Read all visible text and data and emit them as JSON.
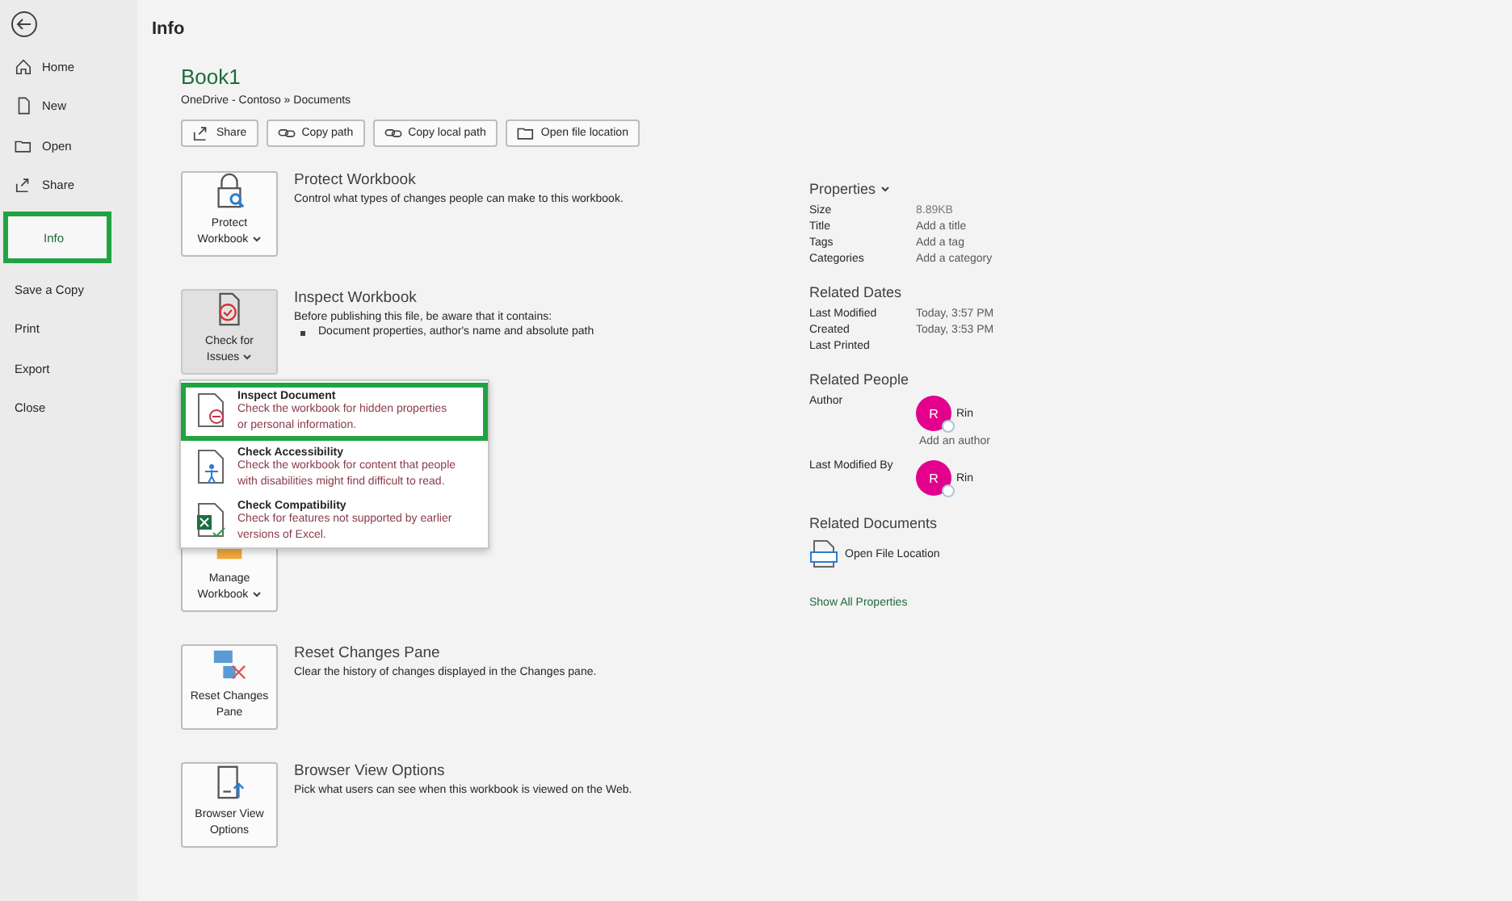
{
  "sidebar": {
    "items": [
      {
        "label": "Home",
        "selected": false
      },
      {
        "label": "New",
        "selected": false
      },
      {
        "label": "Open",
        "selected": false
      },
      {
        "label": "Share",
        "selected": false
      },
      {
        "label": "Info",
        "selected": true
      },
      {
        "label": "Save a Copy",
        "selected": false
      },
      {
        "label": "Print",
        "selected": false
      },
      {
        "label": "Export",
        "selected": false
      },
      {
        "label": "Close",
        "selected": false
      }
    ]
  },
  "page_title": "Info",
  "file": {
    "name": "Book1",
    "path": "OneDrive - Contoso » Documents"
  },
  "file_buttons": [
    {
      "label": "Share"
    },
    {
      "label": "Copy path"
    },
    {
      "label": "Copy local path"
    },
    {
      "label": "Open file location"
    }
  ],
  "sections": [
    {
      "button": [
        "Protect",
        "Workbook"
      ],
      "dropdown": true,
      "title": "Protect Workbook",
      "lines": [
        "Control what types of changes people can make to this workbook."
      ],
      "pressed": false
    },
    {
      "button": [
        "Check for",
        "Issues"
      ],
      "dropdown": true,
      "title": "Inspect Workbook",
      "lines": [
        "Before publishing this file, be aware that it contains:"
      ],
      "bullets": [
        "Document properties, author's name and absolute path"
      ],
      "pressed": true
    },
    {
      "button": [
        "Manage",
        "Workbook"
      ],
      "dropdown": true,
      "pressed": false
    },
    {
      "button": [
        "Reset Changes",
        "Pane"
      ],
      "title": "Reset Changes Pane",
      "lines": [
        "Clear the history of changes displayed in the Changes pane."
      ],
      "pressed": false
    },
    {
      "button": [
        "Browser View",
        "Options"
      ],
      "title": "Browser View Options",
      "lines": [
        "Pick what users can see when this workbook is viewed on the Web."
      ],
      "pressed": false
    }
  ],
  "issues_menu": [
    {
      "title": "Inspect Document",
      "description": [
        "Check the workbook for hidden properties",
        "or personal information."
      ],
      "highlighted": true
    },
    {
      "title": "Check Accessibility",
      "description": [
        "Check the workbook for content that people",
        "with disabilities might find difficult to read."
      ],
      "highlighted": false
    },
    {
      "title": "Check Compatibility",
      "description": [
        "Check for features not supported by earlier",
        "versions of Excel."
      ],
      "highlighted": false
    }
  ],
  "properties": {
    "heading": "Properties",
    "rows": [
      {
        "label": "Size",
        "value": "8.89KB",
        "kind": "static"
      },
      {
        "label": "Title",
        "value": "Add a title",
        "kind": "editable"
      },
      {
        "label": "Tags",
        "value": "Add a tag",
        "kind": "editable"
      },
      {
        "label": "Categories",
        "value": "Add a category",
        "kind": "editable"
      }
    ]
  },
  "related_dates": {
    "heading": "Related Dates",
    "rows": [
      {
        "label": "Last Modified",
        "value": "Today, 3:57 PM"
      },
      {
        "label": "Created",
        "value": "Today, 3:53 PM"
      },
      {
        "label": "Last Printed"
      }
    ]
  },
  "related_people": {
    "heading": "Related People",
    "rows": [
      {
        "label": "Author",
        "person": {
          "initial": "R",
          "name": "Rin",
          "color": "#e3008c"
        },
        "add": "Add an author"
      },
      {
        "label": "Last Modified By",
        "person": {
          "initial": "R",
          "name": "Rin",
          "color": "#e3008c"
        }
      }
    ]
  },
  "related_documents": {
    "heading": "Related Documents",
    "items": [
      {
        "label": "Open File Location"
      }
    ]
  },
  "show_all": "Show All Properties"
}
